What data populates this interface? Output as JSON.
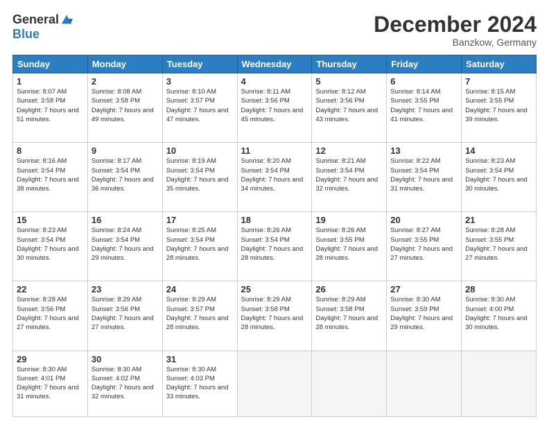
{
  "header": {
    "logo_general": "General",
    "logo_blue": "Blue",
    "month_title": "December 2024",
    "location": "Banzkow, Germany"
  },
  "days_of_week": [
    "Sunday",
    "Monday",
    "Tuesday",
    "Wednesday",
    "Thursday",
    "Friday",
    "Saturday"
  ],
  "weeks": [
    [
      {
        "day": "1",
        "sunrise": "8:07 AM",
        "sunset": "3:58 PM",
        "daylight": "7 hours and 51 minutes."
      },
      {
        "day": "2",
        "sunrise": "8:08 AM",
        "sunset": "3:58 PM",
        "daylight": "7 hours and 49 minutes."
      },
      {
        "day": "3",
        "sunrise": "8:10 AM",
        "sunset": "3:57 PM",
        "daylight": "7 hours and 47 minutes."
      },
      {
        "day": "4",
        "sunrise": "8:11 AM",
        "sunset": "3:56 PM",
        "daylight": "7 hours and 45 minutes."
      },
      {
        "day": "5",
        "sunrise": "8:12 AM",
        "sunset": "3:56 PM",
        "daylight": "7 hours and 43 minutes."
      },
      {
        "day": "6",
        "sunrise": "8:14 AM",
        "sunset": "3:55 PM",
        "daylight": "7 hours and 41 minutes."
      },
      {
        "day": "7",
        "sunrise": "8:15 AM",
        "sunset": "3:55 PM",
        "daylight": "7 hours and 39 minutes."
      }
    ],
    [
      {
        "day": "8",
        "sunrise": "8:16 AM",
        "sunset": "3:54 PM",
        "daylight": "7 hours and 38 minutes."
      },
      {
        "day": "9",
        "sunrise": "8:17 AM",
        "sunset": "3:54 PM",
        "daylight": "7 hours and 36 minutes."
      },
      {
        "day": "10",
        "sunrise": "8:19 AM",
        "sunset": "3:54 PM",
        "daylight": "7 hours and 35 minutes."
      },
      {
        "day": "11",
        "sunrise": "8:20 AM",
        "sunset": "3:54 PM",
        "daylight": "7 hours and 34 minutes."
      },
      {
        "day": "12",
        "sunrise": "8:21 AM",
        "sunset": "3:54 PM",
        "daylight": "7 hours and 32 minutes."
      },
      {
        "day": "13",
        "sunrise": "8:22 AM",
        "sunset": "3:54 PM",
        "daylight": "7 hours and 31 minutes."
      },
      {
        "day": "14",
        "sunrise": "8:23 AM",
        "sunset": "3:54 PM",
        "daylight": "7 hours and 30 minutes."
      }
    ],
    [
      {
        "day": "15",
        "sunrise": "8:23 AM",
        "sunset": "3:54 PM",
        "daylight": "7 hours and 30 minutes."
      },
      {
        "day": "16",
        "sunrise": "8:24 AM",
        "sunset": "3:54 PM",
        "daylight": "7 hours and 29 minutes."
      },
      {
        "day": "17",
        "sunrise": "8:25 AM",
        "sunset": "3:54 PM",
        "daylight": "7 hours and 28 minutes."
      },
      {
        "day": "18",
        "sunrise": "8:26 AM",
        "sunset": "3:54 PM",
        "daylight": "7 hours and 28 minutes."
      },
      {
        "day": "19",
        "sunrise": "8:26 AM",
        "sunset": "3:55 PM",
        "daylight": "7 hours and 28 minutes."
      },
      {
        "day": "20",
        "sunrise": "8:27 AM",
        "sunset": "3:55 PM",
        "daylight": "7 hours and 27 minutes."
      },
      {
        "day": "21",
        "sunrise": "8:28 AM",
        "sunset": "3:55 PM",
        "daylight": "7 hours and 27 minutes."
      }
    ],
    [
      {
        "day": "22",
        "sunrise": "8:28 AM",
        "sunset": "3:56 PM",
        "daylight": "7 hours and 27 minutes."
      },
      {
        "day": "23",
        "sunrise": "8:29 AM",
        "sunset": "3:56 PM",
        "daylight": "7 hours and 27 minutes."
      },
      {
        "day": "24",
        "sunrise": "8:29 AM",
        "sunset": "3:57 PM",
        "daylight": "7 hours and 28 minutes."
      },
      {
        "day": "25",
        "sunrise": "8:29 AM",
        "sunset": "3:58 PM",
        "daylight": "7 hours and 28 minutes."
      },
      {
        "day": "26",
        "sunrise": "8:29 AM",
        "sunset": "3:58 PM",
        "daylight": "7 hours and 28 minutes."
      },
      {
        "day": "27",
        "sunrise": "8:30 AM",
        "sunset": "3:59 PM",
        "daylight": "7 hours and 29 minutes."
      },
      {
        "day": "28",
        "sunrise": "8:30 AM",
        "sunset": "4:00 PM",
        "daylight": "7 hours and 30 minutes."
      }
    ],
    [
      {
        "day": "29",
        "sunrise": "8:30 AM",
        "sunset": "4:01 PM",
        "daylight": "7 hours and 31 minutes."
      },
      {
        "day": "30",
        "sunrise": "8:30 AM",
        "sunset": "4:02 PM",
        "daylight": "7 hours and 32 minutes."
      },
      {
        "day": "31",
        "sunrise": "8:30 AM",
        "sunset": "4:03 PM",
        "daylight": "7 hours and 33 minutes."
      },
      null,
      null,
      null,
      null
    ]
  ]
}
